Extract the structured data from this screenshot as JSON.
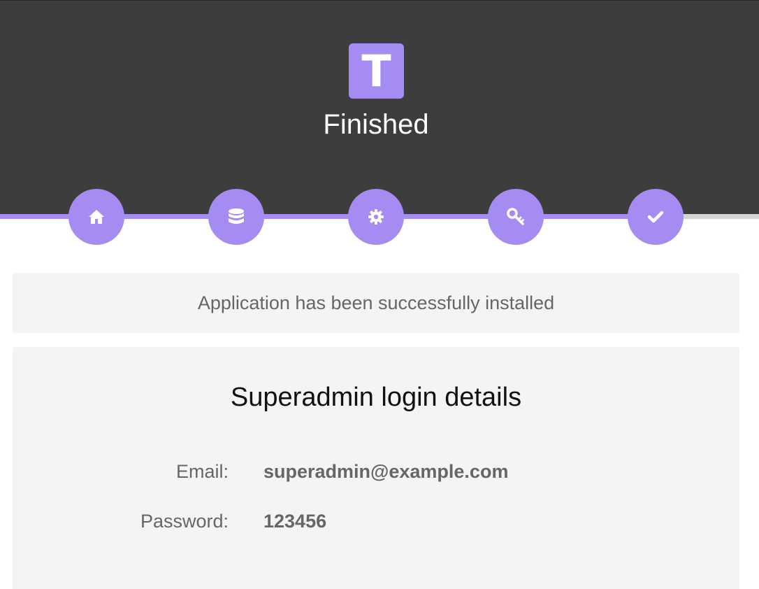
{
  "header": {
    "logo_letter": "T",
    "title": "Finished"
  },
  "progress": {
    "fraction_complete": 0.9,
    "steps": [
      {
        "icon": "home-icon",
        "status": "complete"
      },
      {
        "icon": "database-icon",
        "status": "complete"
      },
      {
        "icon": "gear-icon",
        "status": "complete"
      },
      {
        "icon": "key-icon",
        "status": "complete"
      },
      {
        "icon": "check-icon",
        "status": "current"
      }
    ]
  },
  "alert": {
    "message": "Application has been successfully installed"
  },
  "login_details": {
    "title": "Superadmin login details",
    "email_label": "Email:",
    "email_value": "superadmin@example.com",
    "password_label": "Password:",
    "password_value": "123456"
  },
  "colors": {
    "accent": "#a68bf2",
    "header_bg": "#3d3d3d",
    "panel_bg": "#f4f4f4",
    "track": "#d3d3d3"
  }
}
